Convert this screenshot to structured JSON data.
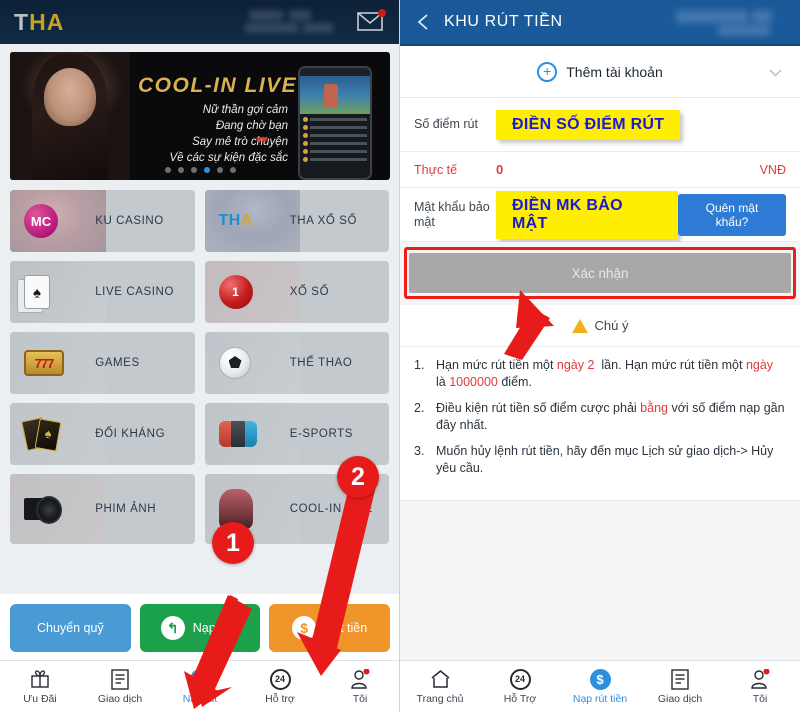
{
  "left": {
    "header": {
      "logo": "THA",
      "mail_icon": "mail-icon"
    },
    "banner": {
      "title": "COOL-IN LIVE",
      "lines": [
        "Nữ thần gợi cảm",
        "Đang chờ bạn",
        "Say mê trò chuyện",
        "Về các sự kiện đặc sắc"
      ],
      "dots": 6,
      "active_dot": 3
    },
    "cards": [
      {
        "label": "KU CASINO",
        "icon": "mc-logo-icon"
      },
      {
        "label": "THA XỔ SỐ",
        "icon": "tha-logo-icon"
      },
      {
        "label": "LIVE CASINO",
        "icon": "playing-cards-icon"
      },
      {
        "label": "XỔ SỐ",
        "icon": "lottery-ball-icon"
      },
      {
        "label": "GAMES",
        "icon": "slot-machine-icon"
      },
      {
        "label": "THỂ THAO",
        "icon": "soccer-ball-icon"
      },
      {
        "label": "ĐỐI KHÁNG",
        "icon": "fight-cards-icon"
      },
      {
        "label": "E-SPORTS",
        "icon": "joycon-icon"
      },
      {
        "label": "PHIM ẢNH",
        "icon": "film-clapper-icon"
      },
      {
        "label": "COOL-IN LIVE",
        "icon": "live-girl-icon"
      }
    ],
    "actions": [
      {
        "label": "Chuyển quỹ",
        "icon": "",
        "color": "#4a9bd4"
      },
      {
        "label": "Nạp tiền",
        "icon": "refund-arrow-icon",
        "color": "#1ca14b"
      },
      {
        "label": "Rút tiền",
        "icon": "dollar-icon",
        "color": "#f0952a"
      }
    ],
    "nav": [
      {
        "label": "Ưu Đãi",
        "icon": "gift-icon",
        "active": false
      },
      {
        "label": "Giao dịch",
        "icon": "document-icon",
        "active": false
      },
      {
        "label": "Nạp rút",
        "icon": "dollar-circle-icon",
        "active": true
      },
      {
        "label": "Hỗ trợ",
        "icon": "support-24-icon",
        "active": false
      },
      {
        "label": "Tôi",
        "icon": "user-icon",
        "active": false
      }
    ]
  },
  "right": {
    "header": {
      "title": "KHU RÚT TIỀN",
      "back_icon": "back-chevron-icon"
    },
    "add_account": {
      "label": "Thêm tài khoản",
      "plus_icon": "plus-circle-icon",
      "chevron_icon": "chevron-down-icon"
    },
    "amount_field": {
      "label": "Số điểm rút",
      "highlight": "ĐIỀN SỐ ĐIỂM RÚT"
    },
    "real_row": {
      "label": "Thực tế",
      "value": "0",
      "unit": "VNĐ"
    },
    "password_field": {
      "label": "Mật khẩu bảo mật",
      "highlight": "ĐIỀN MK BẢO MẬT",
      "forgot_label": "Quên mật khẩu?"
    },
    "confirm": {
      "label": "Xác nhận"
    },
    "notice": {
      "title": "Chú ý",
      "warn_icon": "warning-triangle-icon",
      "items": [
        {
          "num": "1.",
          "parts": [
            {
              "t": "Hạn mức rút tiền một ",
              "c": "dark"
            },
            {
              "t": "ngày",
              "c": "red"
            },
            {
              "t": " 2  ",
              "c": "red"
            },
            {
              "t": "lần. Hạn mức rút tiền một ",
              "c": "dark"
            },
            {
              "t": "ngày",
              "c": "red"
            },
            {
              "t": " là ",
              "c": "dark"
            },
            {
              "t": "1000000",
              "c": "red"
            },
            {
              "t": " điểm.",
              "c": "dark"
            }
          ]
        },
        {
          "num": "2.",
          "parts": [
            {
              "t": "Điều kiện rút tiền số điểm cược phải ",
              "c": "dark"
            },
            {
              "t": "bằng",
              "c": "red"
            },
            {
              "t": " với số điểm nạp gần đây nhất.",
              "c": "dark"
            }
          ]
        },
        {
          "num": "3.",
          "parts": [
            {
              "t": "Muốn hủy lệnh rút tiền, hãy đến mục Lịch sử giao dịch-> Hủy yêu cầu.",
              "c": "dark"
            }
          ]
        }
      ]
    },
    "nav": [
      {
        "label": "Trang chủ",
        "icon": "home-icon",
        "active": false
      },
      {
        "label": "Hỗ Trợ",
        "icon": "support-24-icon",
        "active": false
      },
      {
        "label": "Nạp rút tiền",
        "icon": "dollar-circle-icon",
        "active": true
      },
      {
        "label": "Giao dịch",
        "icon": "document-icon",
        "active": false
      },
      {
        "label": "Tôi",
        "icon": "user-icon",
        "active": false
      }
    ]
  },
  "annotations": {
    "step1": "1",
    "step2": "2",
    "accent_red": "#e81b1b"
  }
}
